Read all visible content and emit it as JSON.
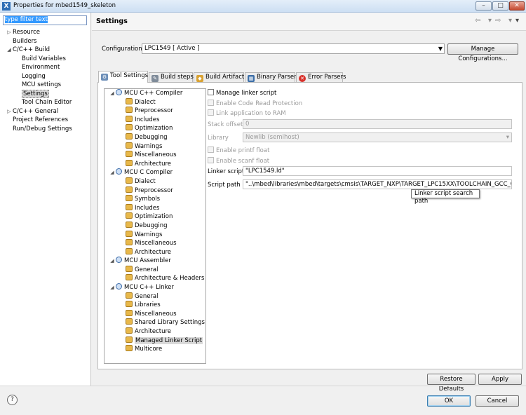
{
  "window": {
    "title": "Properties for mbed1549_skeleton",
    "min": "–",
    "max": "□",
    "close": "✕"
  },
  "nav": {
    "filter_placeholder": "type filter text",
    "items": [
      {
        "label": "Resource",
        "twisty": "▷",
        "indent": 0
      },
      {
        "label": "Builders",
        "twisty": "",
        "indent": 0
      },
      {
        "label": "C/C++ Build",
        "twisty": "◢",
        "indent": 0
      },
      {
        "label": "Build Variables",
        "twisty": "",
        "indent": 1
      },
      {
        "label": "Environment",
        "twisty": "",
        "indent": 1
      },
      {
        "label": "Logging",
        "twisty": "",
        "indent": 1
      },
      {
        "label": "MCU settings",
        "twisty": "",
        "indent": 1
      },
      {
        "label": "Settings",
        "twisty": "",
        "indent": 1,
        "selected": true
      },
      {
        "label": "Tool Chain Editor",
        "twisty": "",
        "indent": 1
      },
      {
        "label": "C/C++ General",
        "twisty": "▷",
        "indent": 0
      },
      {
        "label": "Project References",
        "twisty": "",
        "indent": 0
      },
      {
        "label": "Run/Debug Settings",
        "twisty": "",
        "indent": 0
      }
    ]
  },
  "header": {
    "title": "Settings",
    "back": "⇦",
    "forward": "⇨",
    "menu": "▾"
  },
  "config": {
    "label": "Configuration:",
    "value": "LPC1549  [ Active ]",
    "manage": "Manage Configurations..."
  },
  "tabs": [
    {
      "label": "Tool Settings",
      "icon": "gear-icon",
      "active": true
    },
    {
      "label": "Build steps",
      "icon": "wrench-icon"
    },
    {
      "label": "Build Artifact",
      "icon": "artifact-icon"
    },
    {
      "label": "Binary Parsers",
      "icon": "binary-icon"
    },
    {
      "label": "Error Parsers",
      "icon": "error-icon"
    }
  ],
  "tree": [
    {
      "label": "MCU C++ Compiler",
      "type": "group"
    },
    {
      "label": "Dialect",
      "type": "child"
    },
    {
      "label": "Preprocessor",
      "type": "child"
    },
    {
      "label": "Includes",
      "type": "child"
    },
    {
      "label": "Optimization",
      "type": "child"
    },
    {
      "label": "Debugging",
      "type": "child"
    },
    {
      "label": "Warnings",
      "type": "child"
    },
    {
      "label": "Miscellaneous",
      "type": "child"
    },
    {
      "label": "Architecture",
      "type": "child"
    },
    {
      "label": "MCU C Compiler",
      "type": "group"
    },
    {
      "label": "Dialect",
      "type": "child"
    },
    {
      "label": "Preprocessor",
      "type": "child"
    },
    {
      "label": "Symbols",
      "type": "child"
    },
    {
      "label": "Includes",
      "type": "child"
    },
    {
      "label": "Optimization",
      "type": "child"
    },
    {
      "label": "Debugging",
      "type": "child"
    },
    {
      "label": "Warnings",
      "type": "child"
    },
    {
      "label": "Miscellaneous",
      "type": "child"
    },
    {
      "label": "Architecture",
      "type": "child"
    },
    {
      "label": "MCU Assembler",
      "type": "group"
    },
    {
      "label": "General",
      "type": "child"
    },
    {
      "label": "Architecture & Headers",
      "type": "child"
    },
    {
      "label": "MCU C++ Linker",
      "type": "group"
    },
    {
      "label": "General",
      "type": "child"
    },
    {
      "label": "Libraries",
      "type": "child"
    },
    {
      "label": "Miscellaneous",
      "type": "child"
    },
    {
      "label": "Shared Library Settings",
      "type": "child"
    },
    {
      "label": "Architecture",
      "type": "child"
    },
    {
      "label": "Managed Linker Script",
      "type": "child",
      "selected": true
    },
    {
      "label": "Multicore",
      "type": "child"
    }
  ],
  "form": {
    "manage_linker": "Manage linker script",
    "code_read_protect": "Enable Code Read Protection",
    "link_to_ram": "Link application to RAM",
    "stack_offset_label": "Stack offset",
    "stack_offset_value": "0",
    "library_label": "Library",
    "library_value": "Newlib (semihost)",
    "printf_float": "Enable printf float",
    "scanf_float": "Enable scanf float",
    "linker_script_label": "Linker script",
    "linker_script_value": "\"LPC1549.ld\"",
    "script_path_label": "Script path",
    "script_path_value": "\"..\\mbed\\libraries\\mbed\\targets\\cmsis\\TARGET_NXP\\TARGET_LPC15XX\\TOOLCHAIN_GCC_CR\"",
    "tooltip": "Linker script search path"
  },
  "buttons": {
    "restore": "Restore Defaults",
    "apply": "Apply",
    "ok": "OK",
    "cancel": "Cancel",
    "help": "?"
  }
}
